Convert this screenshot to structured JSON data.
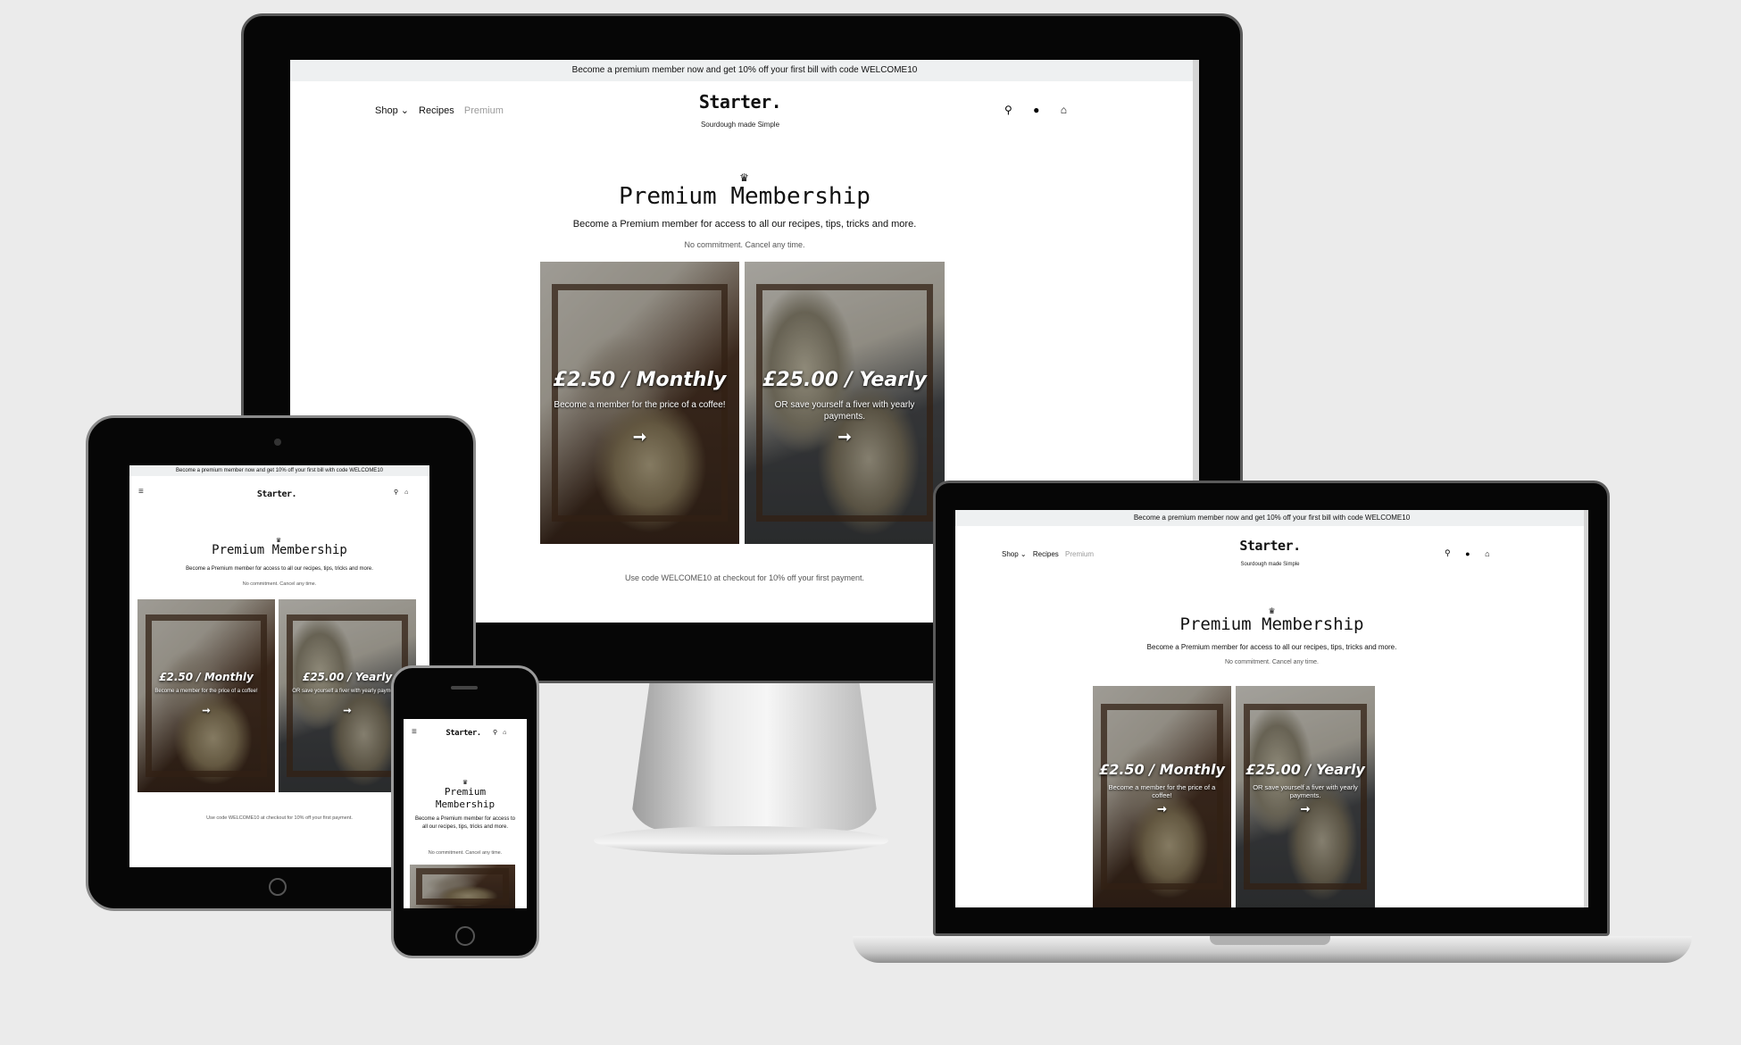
{
  "banner": {
    "text": "Become a premium member now and get 10% off your first bill with code WELCOME10"
  },
  "brand": {
    "logo": "Starter.",
    "tagline": "Sourdough made Simple"
  },
  "nav": {
    "shop": "Shop",
    "recipes": "Recipes",
    "premium": "Premium"
  },
  "icons": {
    "search": "search-icon",
    "account": "user-icon",
    "basket": "basket-icon",
    "menu": "hamburger-menu-icon",
    "crown": "crown-icon",
    "arrow": "arrow-right-icon"
  },
  "hero": {
    "title": "Premium Membership",
    "title_line1": "Premium",
    "title_line2": "Membership",
    "subtitle": "Become a Premium member for access to all our recipes, tips, tricks and more.",
    "subtitle_phone": "Become a Premium member for access to all our recipes, tips, tricks and more.",
    "commitment": "No commitment. Cancel any time."
  },
  "plans": [
    {
      "price": "£2.50 / Monthly",
      "description": "Become a member for the price of a coffee!",
      "arrow": "➞"
    },
    {
      "price": "£25.00 / Yearly",
      "description": "OR save yourself a fiver with yearly payments.",
      "arrow": "➞"
    }
  ],
  "footer_note": "Use code WELCOME10 at checkout for 10% off your first payment.",
  "colors": {
    "banner_bg": "#eef0f1",
    "muted_nav": "#9a9a9a",
    "page_bg": "#ebebeb",
    "bezel": "#060606"
  }
}
